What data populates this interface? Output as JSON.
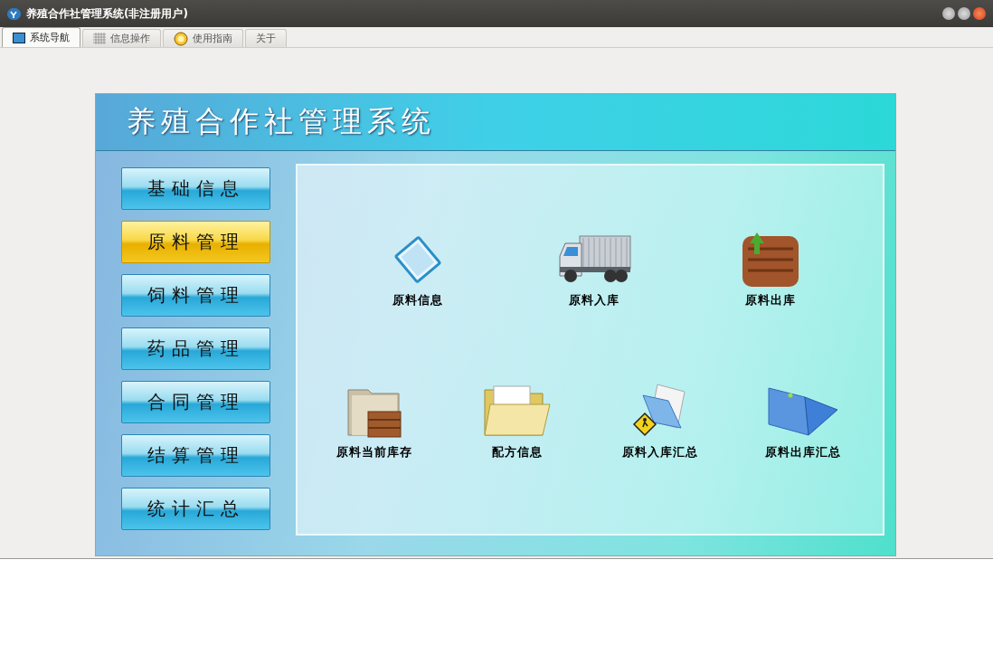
{
  "window": {
    "title": "养殖合作社管理系统(非注册用户)"
  },
  "tabs": [
    {
      "label": "系统导航",
      "kind": "monitor",
      "selected": true
    },
    {
      "label": "信息操作",
      "kind": "grid",
      "selected": false
    },
    {
      "label": "使用指南",
      "kind": "help",
      "selected": false
    },
    {
      "label": "关于",
      "kind": "plain",
      "selected": false
    }
  ],
  "banner": {
    "title": "养殖合作社管理系统"
  },
  "menu": [
    {
      "label": "基础信息",
      "selected": false
    },
    {
      "label": "原料管理",
      "selected": true
    },
    {
      "label": "饲料管理",
      "selected": false
    },
    {
      "label": "药品管理",
      "selected": false
    },
    {
      "label": "合同管理",
      "selected": false
    },
    {
      "label": "结算管理",
      "selected": false
    },
    {
      "label": "统计汇总",
      "selected": false
    }
  ],
  "feature_rows": [
    [
      {
        "label": "原料信息",
        "kind": "document"
      },
      {
        "label": "原料入库",
        "kind": "truck"
      },
      {
        "label": "原料出库",
        "kind": "crate"
      }
    ],
    [
      {
        "label": "原料当前库存",
        "kind": "folder-crate"
      },
      {
        "label": "配方信息",
        "kind": "folder-open"
      },
      {
        "label": "原料入库汇总",
        "kind": "folder-sign"
      },
      {
        "label": "原料出库汇总",
        "kind": "folder-blue"
      }
    ]
  ]
}
